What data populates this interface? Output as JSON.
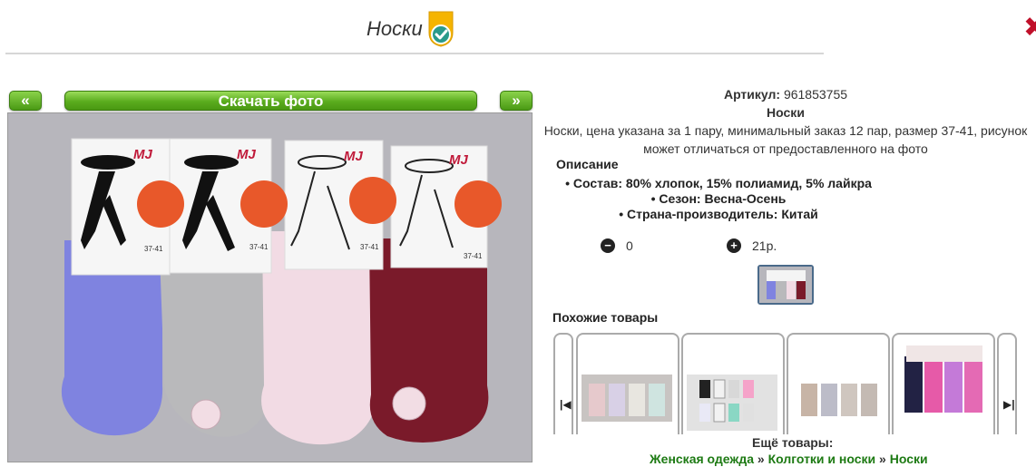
{
  "header": {
    "title": "Носки",
    "badge_icon": "verified-check-icon",
    "close_icon": "close-icon"
  },
  "photo": {
    "prev_label": "«",
    "next_label": "»",
    "download_label": "Скачать фото",
    "package_brand": "MJ",
    "package_type": "женские носки",
    "package_size": "37-41",
    "sock_colors": [
      "#7f83e0",
      "#b9b9bb",
      "#f2dbe4",
      "#7a1a2a"
    ]
  },
  "product": {
    "article_label": "Артикул:",
    "article_value": "961853755",
    "name": "Носки",
    "description": "Носки, цена указана за 1 пару, минимальный заказ 12 пар, размер 37-41, рисунок может отличаться от предоставленного на фото",
    "description_heading": "Описание",
    "specs": [
      "Состав: 80% хлопок, 15% полиамид, 5% лайкра",
      "Сезон: Весна-Осень",
      "Страна-производитель: Китай"
    ]
  },
  "order": {
    "minus_icon": "minus-circle-icon",
    "quantity": "0",
    "plus_icon": "plus-circle-icon",
    "price": "21р."
  },
  "similar": {
    "heading": "Похожие товары",
    "prev_icon": "skip-prev-icon",
    "next_icon": "skip-next-icon"
  },
  "more": {
    "heading": "Ещё товары:",
    "crumbs": [
      "Женская одежда",
      "Колготки и носки",
      "Носки"
    ],
    "separator": "»"
  },
  "colors": {
    "accent_green": "#5aac1e",
    "link_green": "#1d7a13"
  }
}
